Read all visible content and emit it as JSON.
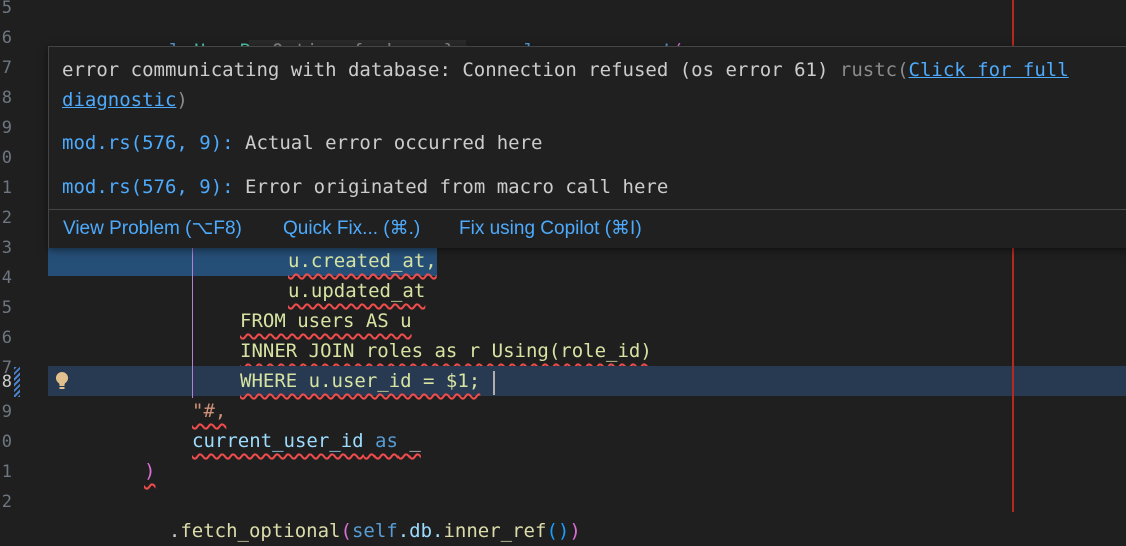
{
  "gutter": {
    "line_numbers": [
      "5",
      "6",
      "7",
      "8",
      "9",
      "0",
      "1",
      "2",
      "3",
      "4",
      "5",
      "6",
      "7",
      "8",
      "9",
      "0",
      "1",
      "2"
    ],
    "active_line": "8"
  },
  "code": {
    "l1_let": "let",
    "l1_row": "row",
    "l1_colon": ":",
    "l1_hint": " Option<{unknown}>",
    "l1_eq": " = ",
    "l1_macro": "sqlx::query_as!",
    "l1_paren": "(",
    "l2_text": "UserR",
    "l14": "u.created_at,",
    "l15": "u.updated_at",
    "l16": "FROM users AS u",
    "l17": "INNER JOIN roles as r Using(role_id)",
    "l18": "WHERE u.user_id = $1;",
    "l19": "\"#,",
    "l20_var": "current_user_id",
    "l20_as": "as",
    "l20_tail": "_",
    "l21": ")",
    "l22_dot": ".",
    "l22_fn": "fetch_optional",
    "l22_p1": "(",
    "l22_self": "self",
    "l22_mid": ".db.",
    "l22_fn2": "inner_ref",
    "l22_p2": "()",
    "l22_p3": ")"
  },
  "hover": {
    "error_main": "error communicating with database: Connection refused (os error 61)",
    "source": "rustc(",
    "link_part1": "Click for full",
    "link_part2": "diagnostic",
    "close_paren": ")",
    "related": [
      {
        "loc": "mod.rs(576, 9):",
        "text": "Actual error occurred here"
      },
      {
        "loc": "mod.rs(576, 9):",
        "text": "Error originated from macro call here"
      }
    ],
    "actions": {
      "view_problem": "View Problem (⌥F8)",
      "quick_fix": "Quick Fix... (⌘.)",
      "copilot": "Fix using Copilot (⌘I)"
    }
  },
  "colors": {
    "background": "#1f1f1f",
    "error_squiggle": "#f14c4c",
    "link": "#4daafc"
  },
  "icons": [
    "lightbulb-icon"
  ]
}
